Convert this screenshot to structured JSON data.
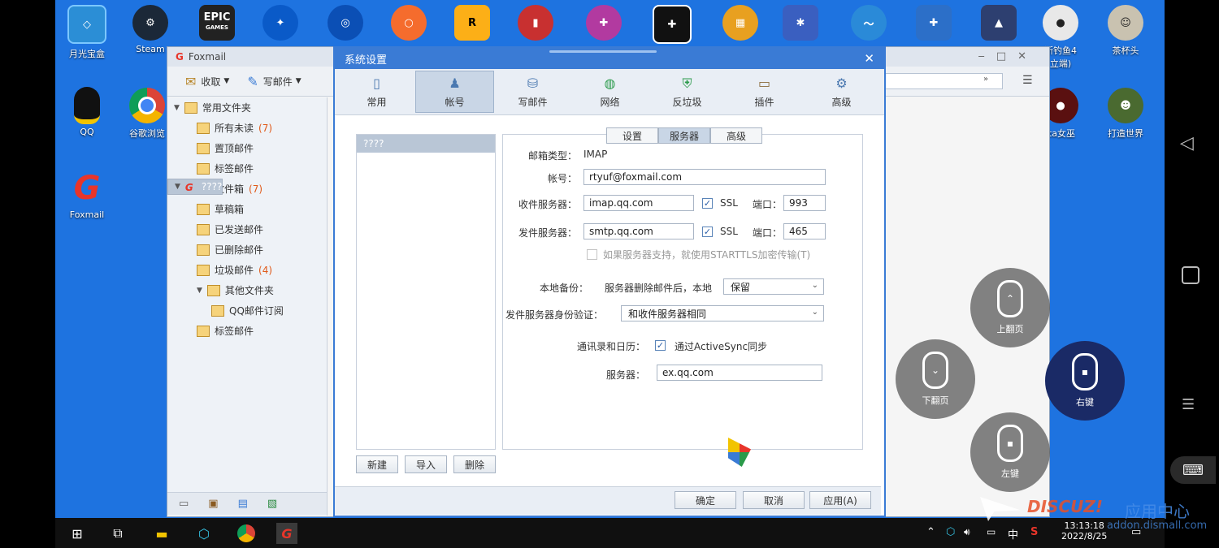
{
  "desktop": {
    "icons_row1": [
      "月光宝盒",
      "Steam",
      "",
      "",
      "",
      "",
      "",
      "",
      "",
      "",
      "",
      "",
      "",
      "",
      "",
      "",
      "",
      "斯钓鱼4",
      "茶杯头"
    ],
    "icons_row1_epic": "EPIC",
    "icons_row1_epic_sub": "GAMES",
    "icons_col1": [
      "QQ",
      "Foxmail"
    ],
    "icons_col2": [
      "谷歌浏览"
    ],
    "icons_right": [
      "ita女巫",
      "打造世界"
    ],
    "right_partial": "立端)"
  },
  "foxmail": {
    "title": "Foxmail",
    "toolbar": {
      "receive": "收取",
      "compose": "写邮件"
    },
    "folders": [
      {
        "label": "常用文件夹",
        "count": "",
        "indent": 0,
        "header": true
      },
      {
        "label": "所有未读",
        "count": "(7)",
        "indent": 1
      },
      {
        "label": "置顶邮件",
        "count": "",
        "indent": 1
      },
      {
        "label": "标签邮件",
        "count": "",
        "indent": 1
      },
      {
        "label": "????",
        "count": "",
        "indent": 0,
        "account": true
      },
      {
        "label": "收件箱",
        "count": "(7)",
        "indent": 1
      },
      {
        "label": "草稿箱",
        "count": "",
        "indent": 1
      },
      {
        "label": "已发送邮件",
        "count": "",
        "indent": 1
      },
      {
        "label": "已删除邮件",
        "count": "",
        "indent": 1
      },
      {
        "label": "垃圾邮件",
        "count": "(4)",
        "indent": 1
      },
      {
        "label": "其他文件夹",
        "count": "",
        "indent": 1
      },
      {
        "label": "QQ邮件订阅",
        "count": "",
        "indent": 2
      },
      {
        "label": "标签邮件",
        "count": "",
        "indent": 1
      }
    ]
  },
  "dialog": {
    "title": "系统设置",
    "tabs": [
      "常用",
      "帐号",
      "写邮件",
      "网络",
      "反垃圾",
      "插件",
      "高级"
    ],
    "active_tab": "帐号",
    "account_item": "????",
    "subtabs": [
      "设置",
      "服务器",
      "高级"
    ],
    "active_subtab": "服务器",
    "mailbox_type_label": "邮箱类型：",
    "mailbox_type_value": "IMAP",
    "account_label": "帐号：",
    "account_value": "rtyuf@foxmail.com",
    "incoming_label": "收件服务器：",
    "incoming_value": "imap.qq.com",
    "incoming_ssl": "SSL",
    "incoming_port_label": "端口：",
    "incoming_port": "993",
    "outgoing_label": "发件服务器：",
    "outgoing_value": "smtp.qq.com",
    "outgoing_ssl": "SSL",
    "outgoing_port_label": "端口：",
    "outgoing_port": "465",
    "starttls": "如果服务器支持，就使用STARTTLS加密传输(T)",
    "backup_label": "本地备份：",
    "backup_text": "服务器删除邮件后，本地",
    "backup_value": "保留",
    "auth_label": "发件服务器身份验证：",
    "auth_value": "和收件服务器相同",
    "contacts_label": "通讯录和日历：",
    "activesync": "通过ActiveSync同步",
    "server_label": "服务器：",
    "server_value": "ex.qq.com",
    "btn_new": "新建",
    "btn_import": "导入",
    "btn_delete": "删除",
    "btn_ok": "确定",
    "btn_cancel": "取消",
    "btn_apply": "应用(A)"
  },
  "gamepad": {
    "page_up": "上翻页",
    "page_down": "下翻页",
    "right_click": "右键",
    "left_click": "左键"
  },
  "taskbar": {
    "time": "13:13:18",
    "date": "2022/8/25",
    "ime": "中"
  },
  "watermark": {
    "text": "应用中心",
    "url": "addon.dismall.com"
  }
}
